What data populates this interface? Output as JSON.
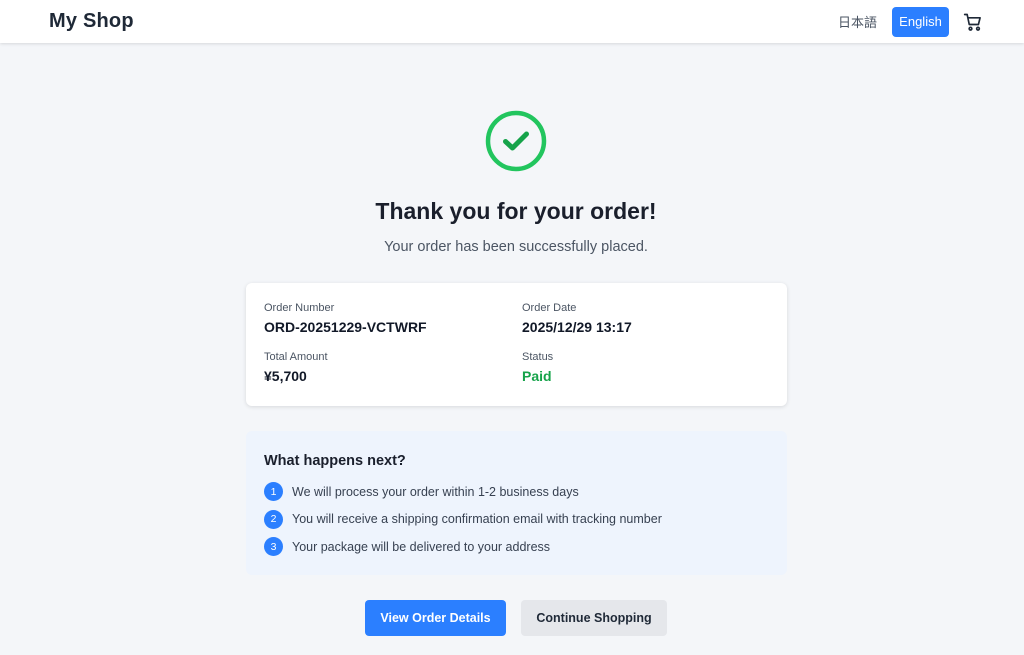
{
  "header": {
    "logo": "My Shop",
    "lang_ja": "日本語",
    "lang_en": "English",
    "cart_icon": "cart-icon"
  },
  "confirmation": {
    "icon": "check-circle-icon",
    "title": "Thank you for your order!",
    "subtitle": "Your order has been successfully placed."
  },
  "order": {
    "number_label": "Order Number",
    "number": "ORD-20251229-VCTWRF",
    "date_label": "Order Date",
    "date": "2025/12/29 13:17",
    "total_label": "Total Amount",
    "total": "¥5,700",
    "status_label": "Status",
    "status": "Paid"
  },
  "next": {
    "title": "What happens next?",
    "steps": [
      {
        "num": "1",
        "text": "We will process your order within 1-2 business days"
      },
      {
        "num": "2",
        "text": "You will receive a shipping confirmation email with tracking number"
      },
      {
        "num": "3",
        "text": "Your package will be delivered to your address"
      }
    ]
  },
  "actions": {
    "view_details": "View Order Details",
    "continue_shopping": "Continue Shopping"
  },
  "colors": {
    "accent": "#2b7fff",
    "success": "#16a34a",
    "success_icon": "#22c55e"
  }
}
